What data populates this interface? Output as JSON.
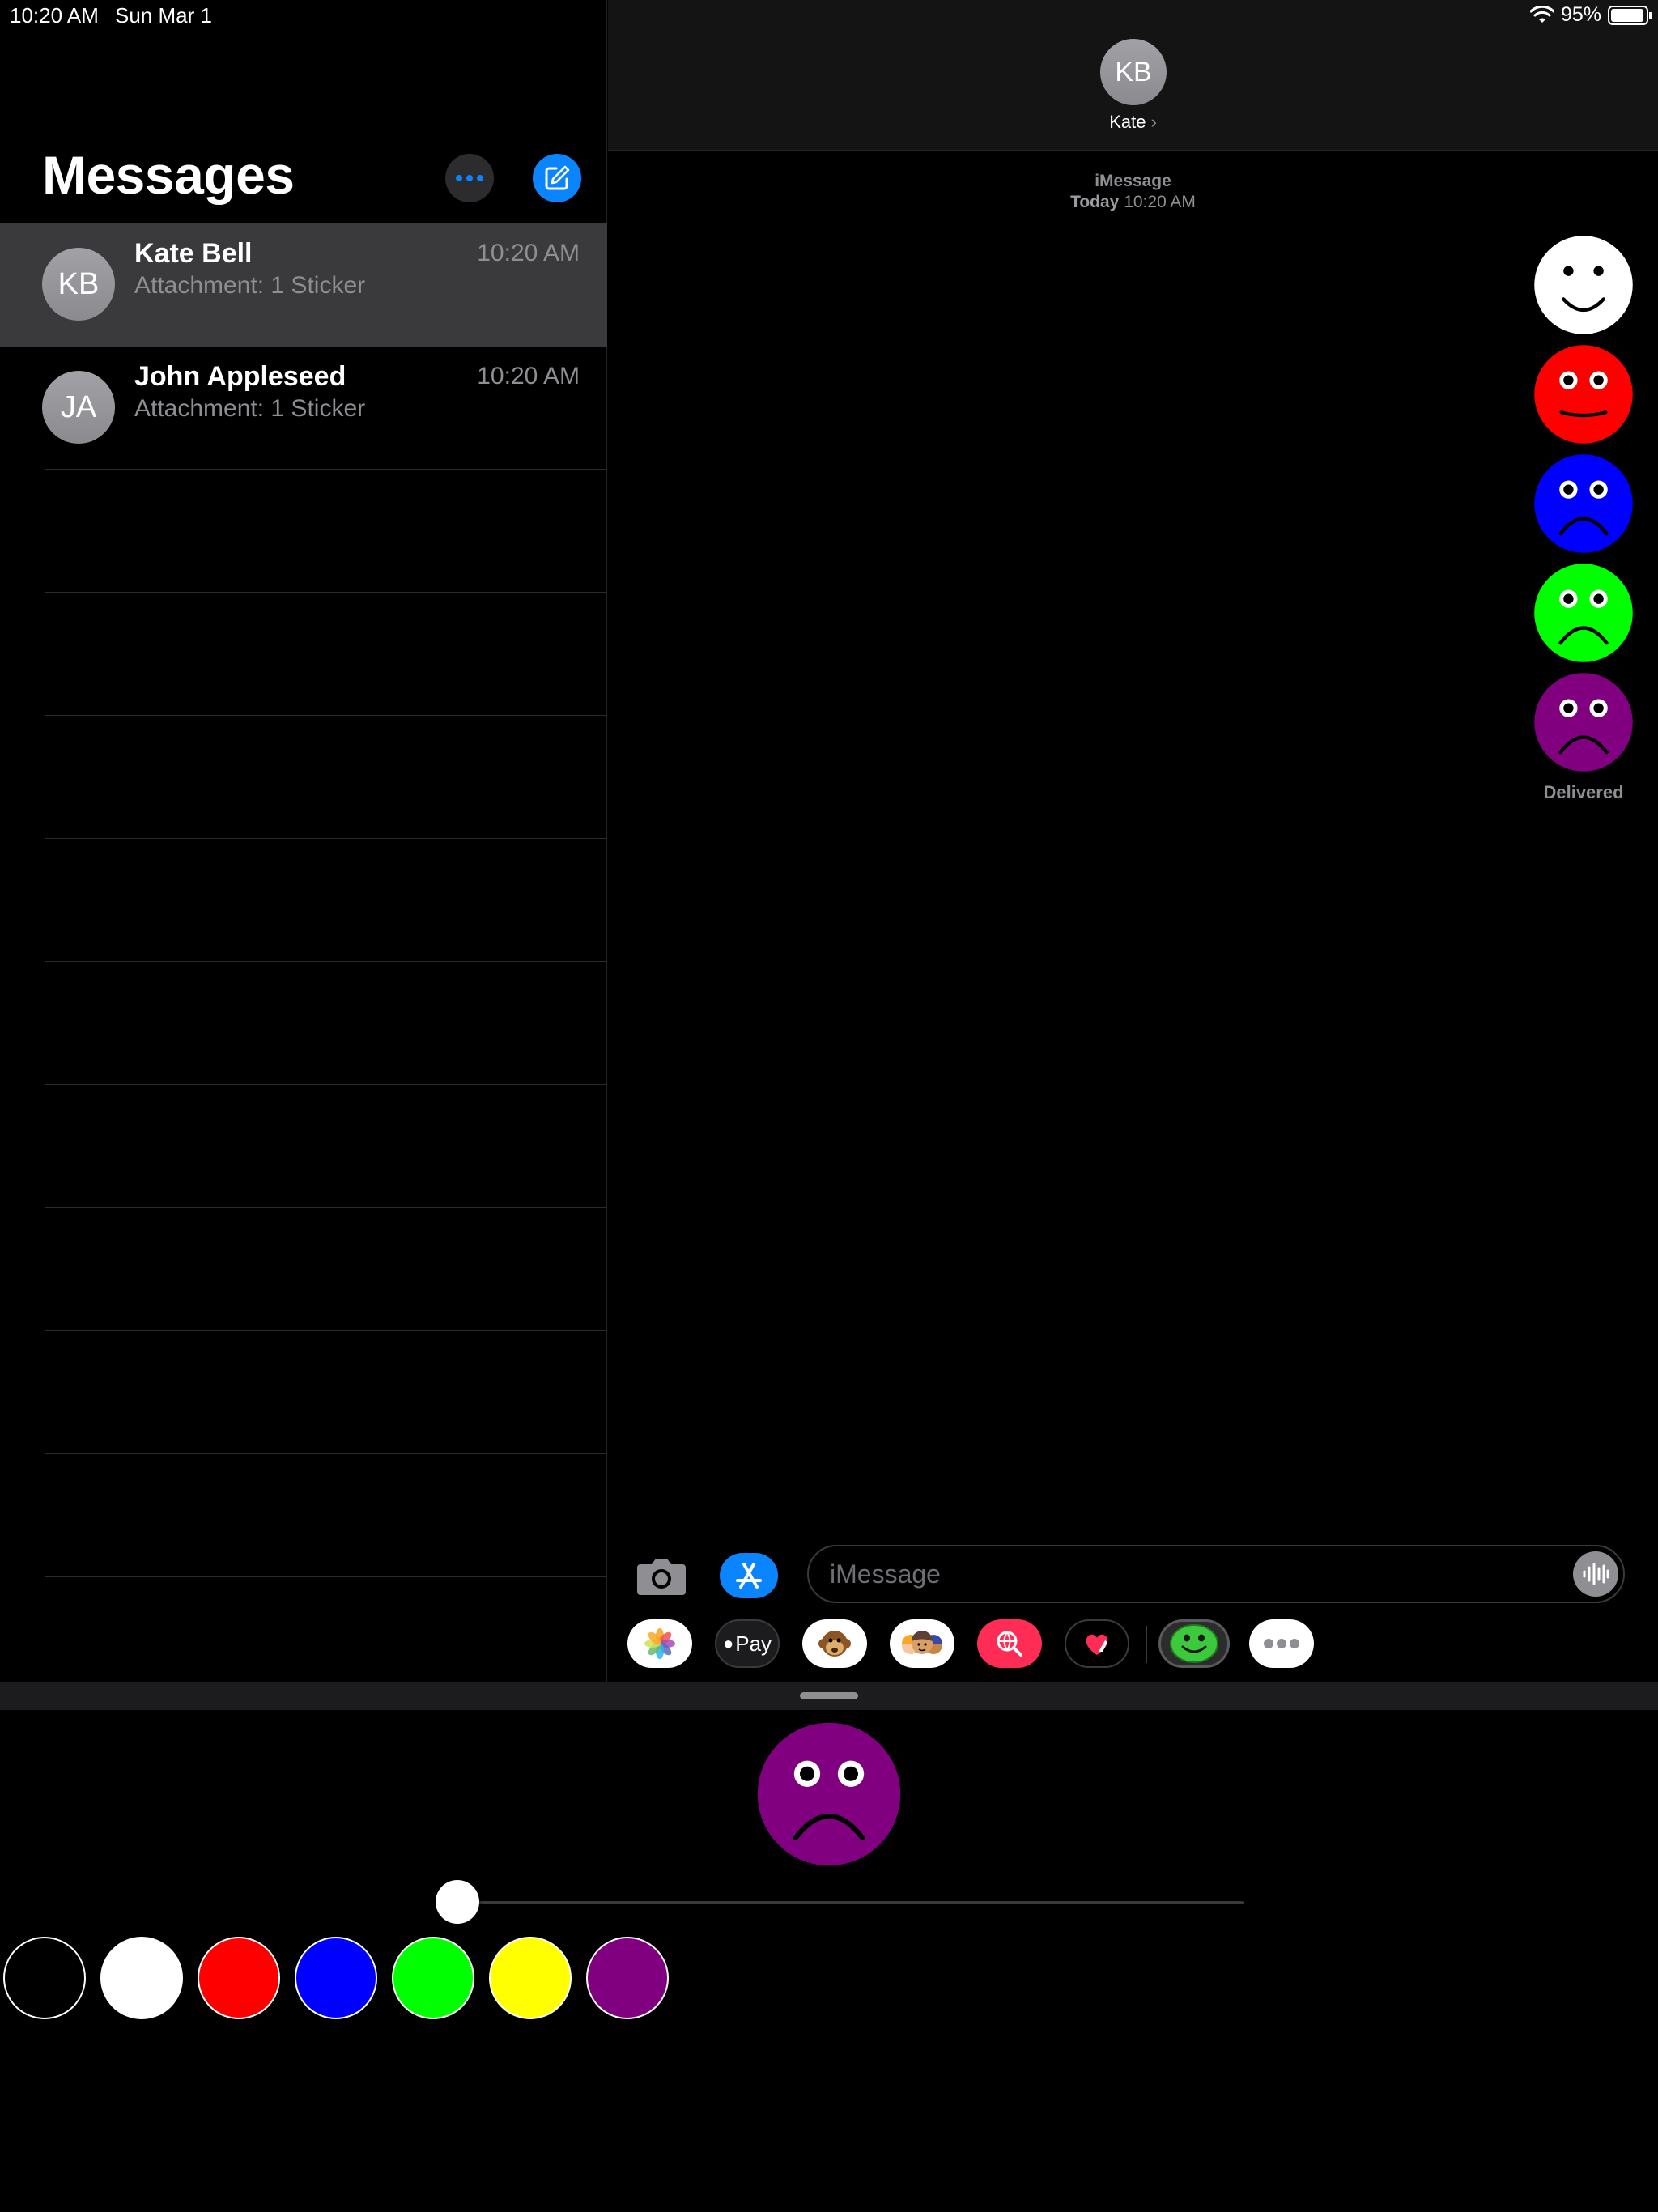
{
  "status_bar": {
    "time": "10:20 AM",
    "date": "Sun Mar 1",
    "battery": "95%",
    "battery_level": 0.95
  },
  "sidebar": {
    "title": "Messages",
    "conversations": [
      {
        "initials": "KB",
        "name": "Kate Bell",
        "preview": "Attachment: 1 Sticker",
        "time": "10:20 AM",
        "selected": true
      },
      {
        "initials": "JA",
        "name": "John Appleseed",
        "preview": "Attachment: 1 Sticker",
        "time": "10:20 AM",
        "selected": false
      }
    ]
  },
  "conversation": {
    "avatar_initials": "KB",
    "contact_name": "Kate",
    "service": "iMessage",
    "timestamp_day": "Today",
    "timestamp_time": "10:20 AM",
    "stickers": [
      {
        "color": "#ffffff",
        "mood": "happy"
      },
      {
        "color": "#ff0000",
        "mood": "neutral"
      },
      {
        "color": "#0000ff",
        "mood": "sad"
      },
      {
        "color": "#00ff00",
        "mood": "sad"
      },
      {
        "color": "#800080",
        "mood": "sad"
      }
    ],
    "delivered_label": "Delivered",
    "input_placeholder": "iMessage",
    "app_drawer": [
      {
        "name": "photos-app-icon",
        "label": ""
      },
      {
        "name": "apple-pay-app-icon",
        "label": "Pay"
      },
      {
        "name": "animoji-app-icon",
        "label": ""
      },
      {
        "name": "memoji-stickers-app-icon",
        "label": ""
      },
      {
        "name": "images-search-app-icon",
        "label": ""
      },
      {
        "name": "digital-touch-app-icon",
        "label": ""
      },
      {
        "name": "sticker-app-icon",
        "label": ""
      },
      {
        "name": "more-apps-icon",
        "label": ""
      }
    ]
  },
  "sticker_panel": {
    "preview": {
      "color": "#800080",
      "mood": "sad"
    },
    "slider_value": 0.0,
    "colors": [
      "#000000",
      "#ffffff",
      "#ff0000",
      "#0000ff",
      "#00ff00",
      "#ffff00",
      "#800080"
    ]
  },
  "colors": {
    "accent": "#0a84ff",
    "selected_row": "#3a3a3c",
    "secondary_text": "#8e8e93"
  }
}
